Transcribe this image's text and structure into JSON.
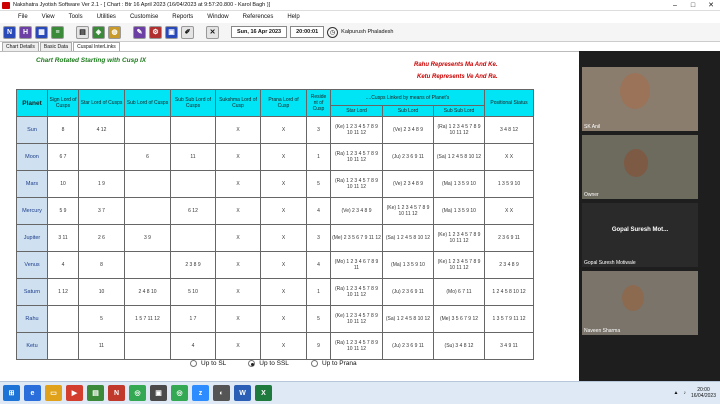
{
  "window": {
    "title": "Nakshatra Jyotish Software Ver 2.1 - [ Chart : Btr 16 April 2023 (16/04/2023 at 9:57:20.800 - Karol Bagh )]"
  },
  "menu": [
    "File",
    "View",
    "Tools",
    "Utilities",
    "Customise",
    "Reports",
    "Window",
    "References",
    "Help"
  ],
  "toolbar": {
    "date": "Sun, 16 Apr 2023",
    "time": "20:00:01",
    "place": "Kalpurush Phaladesh"
  },
  "tabs": [
    "Chart Details",
    "Basic Data",
    "Cuspal InterLinks"
  ],
  "panel": {
    "heading": "Chart Rotated Starting with Cusp IX",
    "note1": "Rahu Represents Ma And Ke.",
    "note2": "Ketu Represents Ve And Ra.",
    "headers": [
      "Planet",
      "Sign Lord of Cusps",
      "Star Lord of Cusps",
      "Sub Lord of Cusps",
      "Sub Sub Lord of Cusps",
      "Sukshma Lord of Cusp",
      "Prana Lord of Cusp",
      "Reside nt of Cusp",
      "....Cusps Linked by means of Planet's",
      "Positional Status"
    ],
    "subheaders": [
      "Star Lord",
      "Sub Lord",
      "Sub Sub Lord"
    ],
    "rows": [
      {
        "planet": "Sun",
        "sign": "8",
        "star": "4 12",
        "sub": "",
        "subsub": "",
        "sukshma": "X",
        "prana": "X",
        "res": "3",
        "c1": "(Ke) 1 2 3 4 5 7 8 9 10 11 12",
        "c2": "(Ve) 2 3 4 8 9",
        "c3": "(Ra) 1 2 3 4 5 7 8 9 10 11 12",
        "pos": "3 4 8 12"
      },
      {
        "planet": "Moon",
        "sign": "6 7",
        "star": "",
        "sub": "6",
        "subsub": "11",
        "sukshma": "X",
        "prana": "X",
        "res": "1",
        "c1": "(Ra) 1 2 3 4 5 7 8 9 10 11 12",
        "c2": "(Ju) 2 3 6 9 11",
        "c3": "(Sa) 1 2 4 5 8 10 12",
        "pos": "X X"
      },
      {
        "planet": "Mars",
        "sign": "10",
        "star": "1 9",
        "sub": "",
        "subsub": "",
        "sukshma": "X",
        "prana": "X",
        "res": "5",
        "c1": "(Ra) 1 2 3 4 5 7 8 9 10 11 12",
        "c2": "(Ve) 2 3 4 8 9",
        "c3": "(Ma) 1 3 5 9 10",
        "pos": "1 3 5 9 10"
      },
      {
        "planet": "Mercury",
        "sign": "5 9",
        "star": "3 7",
        "sub": "",
        "subsub": "6 12",
        "sukshma": "X",
        "prana": "X",
        "res": "4",
        "c1": "(Ve) 2 3 4 8 9",
        "c2": "(Ke) 1 2 3 4 5 7 8 9 10 11 12",
        "c3": "(Ma) 1 3 5 9 10",
        "pos": "X X"
      },
      {
        "planet": "Jupiter",
        "sign": "3 11",
        "star": "2 6",
        "sub": "3 9",
        "subsub": "",
        "sukshma": "X",
        "prana": "X",
        "res": "3",
        "c1": "(Me) 2 3 5 6 7 9 11 12",
        "c2": "(Sa) 1 2 4 5 8 10 12",
        "c3": "(Ke) 1 2 3 4 5 7 8 9 10 11 12",
        "pos": "2 3 6 9 11"
      },
      {
        "planet": "Venus",
        "sign": "4",
        "star": "8",
        "sub": "",
        "subsub": "2 3 8 9",
        "sukshma": "X",
        "prana": "X",
        "res": "4",
        "c1": "(Mo) 1 2 3 4 6 7 8 9 11",
        "c2": "(Ma) 1 3 5 9 10",
        "c3": "(Ke) 1 2 3 4 5 7 8 9 10 11 12",
        "pos": "2 3 4 8 9"
      },
      {
        "planet": "Saturn",
        "sign": "1 12",
        "star": "10",
        "sub": "2 4 8 10",
        "subsub": "5 10",
        "sukshma": "X",
        "prana": "X",
        "res": "1",
        "c1": "(Ra) 1 2 3 4 5 7 8 9 10 11 12",
        "c2": "(Ju) 2 3 6 9 11",
        "c3": "(Mo) 6 7 11",
        "pos": "1 2 4 5 8 10 12"
      },
      {
        "planet": "Rahu",
        "sign": "",
        "star": "5",
        "sub": "1 5 7 11 12",
        "subsub": "1 7",
        "sukshma": "X",
        "prana": "X",
        "res": "5",
        "c1": "(Ke) 1 2 3 4 5 7 8 9 10 11 12",
        "c2": "(Sa) 1 2 4 5 8 10 12",
        "c3": "(Me) 3 5 6 7 9 12",
        "pos": "1 3 5 7 9 11 12"
      },
      {
        "planet": "Ketu",
        "sign": "",
        "star": "11",
        "sub": "",
        "subsub": "4",
        "sukshma": "X",
        "prana": "X",
        "res": "9",
        "c1": "(Ra) 1 2 3 4 5 7 8 9 10 11 12",
        "c2": "(Ju) 2 3 6 9 11",
        "c3": "(Su) 3 4 8 12",
        "pos": "3 4 9 11"
      }
    ],
    "options": [
      {
        "label": "Up to SL",
        "selected": false
      },
      {
        "label": "Up to SSL",
        "selected": true
      },
      {
        "label": "Up to Prana",
        "selected": false
      }
    ]
  },
  "video": {
    "p1": "SK Anil",
    "p2": "Owner",
    "p3": "Gopal Suresh Mot...",
    "p3label": "Gopal Suresh Motiwale",
    "p4": "Naveen Sharma"
  },
  "taskbar": {
    "time": "20:00",
    "date": "16/04/2023"
  }
}
